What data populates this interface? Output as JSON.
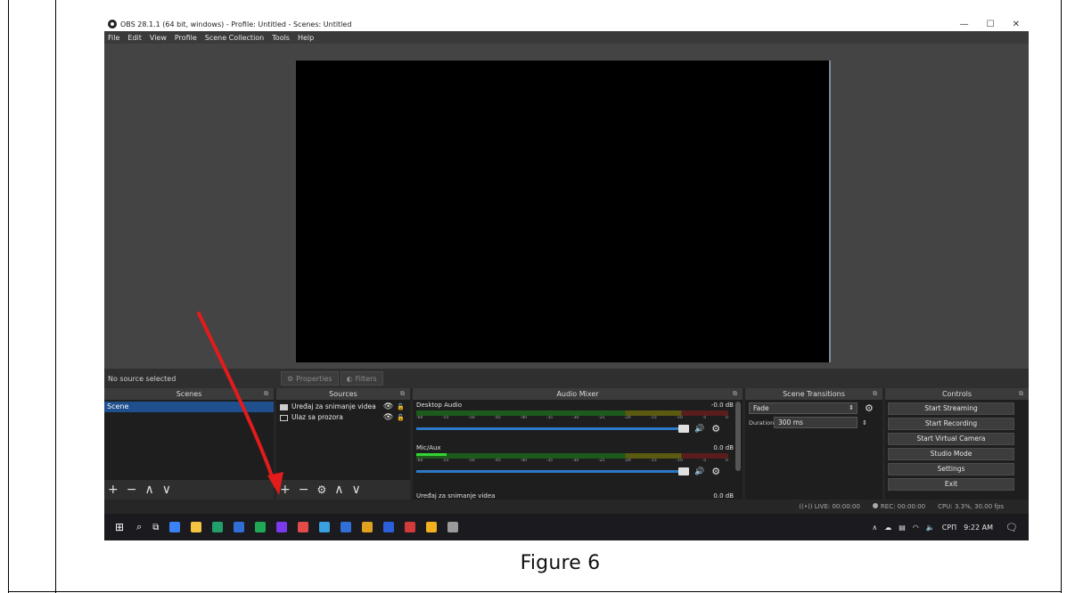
{
  "caption": "Figure 6",
  "window": {
    "title": "OBS 28.1.1 (64 bit, windows) - Profile: Untitled - Scenes: Untitled",
    "minimize": "—",
    "maximize": "☐",
    "close": "✕"
  },
  "menu": [
    "File",
    "Edit",
    "View",
    "Profile",
    "Scene Collection",
    "Tools",
    "Help"
  ],
  "source_bar": {
    "status": "No source selected",
    "properties": "Properties",
    "filters": "Filters"
  },
  "scenes": {
    "header": "Scenes",
    "items": [
      "Scene"
    ]
  },
  "sources": {
    "header": "Sources",
    "items": [
      "Uređaj za snimanje videa",
      "Ulaz sa prozora"
    ]
  },
  "mixer": {
    "header": "Audio Mixer",
    "channels": [
      {
        "name": "Desktop Audio",
        "db": "-0.0 dB",
        "volume": 1.0
      },
      {
        "name": "Mic/Aux",
        "db": "0.0 dB",
        "volume": 1.0
      },
      {
        "name": "Uređaj za snimanje videa",
        "db": "0.0 dB",
        "volume": 1.0
      }
    ],
    "ticks": [
      "-60",
      "-55",
      "-50",
      "-45",
      "-40",
      "-35",
      "-30",
      "-25",
      "-20",
      "-15",
      "-10",
      "-5",
      "0"
    ]
  },
  "transitions": {
    "header": "Scene Transitions",
    "selected": "Fade",
    "duration_label": "Duration",
    "duration_value": "300 ms"
  },
  "controls": {
    "header": "Controls",
    "buttons": [
      "Start Streaming",
      "Start Recording",
      "Start Virtual Camera",
      "Studio Mode",
      "Settings",
      "Exit"
    ]
  },
  "status": {
    "live": "LIVE: 00:00:00",
    "rec": "REC: 00:00:00",
    "cpu": "CPU: 3.3%, 30.00 fps"
  },
  "taskbar": {
    "lang": "CPΠ",
    "time": "9:22 AM",
    "icon_colors": [
      "#3b82f6",
      "#f5c542",
      "#22a06b",
      "#2f6fd6",
      "#1fa855",
      "#7c3aed",
      "#e34b4b",
      "#3aa0e0",
      "#2f6fd6",
      "#e0a020",
      "#2b5fd9",
      "#d33a3a",
      "#f2b01e",
      "#9a9a9a"
    ]
  },
  "accent": {
    "arrow": "#e21b1b",
    "selection": "#1f4f8c"
  }
}
